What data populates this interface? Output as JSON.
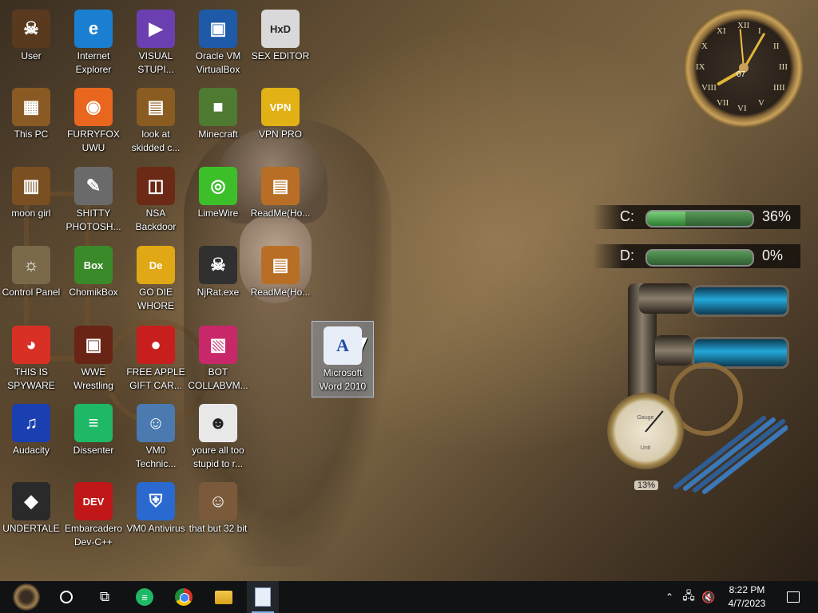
{
  "desktop": {
    "icons": [
      {
        "label": "User",
        "glyph": "☠",
        "bg": "#5a3a1e",
        "col": 0,
        "row": 0
      },
      {
        "label": "Internet Explorer",
        "glyph": "e",
        "bg": "#1a7fd0",
        "col": 1,
        "row": 0
      },
      {
        "label": "VISUAL STUPI...",
        "glyph": "▶",
        "bg": "#6b3fb0",
        "col": 2,
        "row": 0
      },
      {
        "label": "Oracle VM VirtualBox",
        "glyph": "▣",
        "bg": "#1f5aa8",
        "col": 3,
        "row": 0
      },
      {
        "label": "SEX EDITOR",
        "glyph": "HxD",
        "bg": "#d9d9d9",
        "col": 4,
        "row": 0
      },
      {
        "label": "This PC",
        "glyph": "▦",
        "bg": "#8a5a24",
        "col": 0,
        "row": 1
      },
      {
        "label": "FURRYFOX UWU",
        "glyph": "◉",
        "bg": "#e8661e",
        "col": 1,
        "row": 1
      },
      {
        "label": "look at skidded c...",
        "glyph": "▤",
        "bg": "#8a5c22",
        "col": 2,
        "row": 1
      },
      {
        "label": "Minecraft",
        "glyph": "■",
        "bg": "#4e7a32",
        "col": 3,
        "row": 1
      },
      {
        "label": "VPN PRO",
        "glyph": "VPN",
        "bg": "#e2b116",
        "col": 4,
        "row": 1
      },
      {
        "label": "moon girl",
        "glyph": "▥",
        "bg": "#7a5022",
        "col": 0,
        "row": 2
      },
      {
        "label": "SHITTY PHOTOSH...",
        "glyph": "✎",
        "bg": "#6a6a6a",
        "col": 1,
        "row": 2
      },
      {
        "label": "NSA Backdoor",
        "glyph": "◫",
        "bg": "#6a2a16",
        "col": 2,
        "row": 2
      },
      {
        "label": "LimeWire",
        "glyph": "◎",
        "bg": "#3dbf2a",
        "col": 3,
        "row": 2
      },
      {
        "label": "ReadMe(Ho...",
        "glyph": "▤",
        "bg": "#b86f25",
        "col": 4,
        "row": 2
      },
      {
        "label": "Control Panel",
        "glyph": "☼",
        "bg": "#7a6a4a",
        "col": 0,
        "row": 3
      },
      {
        "label": "ChomikBox",
        "glyph": "Box",
        "bg": "#3a8a2a",
        "col": 1,
        "row": 3
      },
      {
        "label": "GO DIE WHORE",
        "glyph": "De",
        "bg": "#e0a814",
        "col": 2,
        "row": 3
      },
      {
        "label": "NjRat.exe",
        "glyph": "☠",
        "bg": "#303030",
        "col": 3,
        "row": 3
      },
      {
        "label": "ReadMe(Ho...",
        "glyph": "▤",
        "bg": "#b86f25",
        "col": 4,
        "row": 3
      },
      {
        "label": "THIS IS SPYWARE",
        "glyph": "◕",
        "bg": "#d93025",
        "col": 0,
        "row": 4
      },
      {
        "label": "WWE Wrestling",
        "glyph": "▣",
        "bg": "#6a2416",
        "col": 1,
        "row": 4
      },
      {
        "label": "FREE APPLE GIFT CAR...",
        "glyph": "●",
        "bg": "#c81e1e",
        "col": 2,
        "row": 4
      },
      {
        "label": "BOT COLLABVM...",
        "glyph": "▧",
        "bg": "#c8286a",
        "col": 3,
        "row": 4
      },
      {
        "label": "Audacity",
        "glyph": "♫",
        "bg": "#1a3fb0",
        "col": 0,
        "row": 5
      },
      {
        "label": "Dissenter",
        "glyph": "≡",
        "bg": "#1fb866",
        "col": 1,
        "row": 5
      },
      {
        "label": "VM0 Technic...",
        "glyph": "☺",
        "bg": "#4a7ab0",
        "col": 2,
        "row": 5
      },
      {
        "label": "youre all too stupid to r...",
        "glyph": "☻",
        "bg": "#e8e8e8",
        "col": 3,
        "row": 5
      },
      {
        "label": "UNDERTALE",
        "glyph": "◆",
        "bg": "#2a2a2a",
        "col": 0,
        "row": 6
      },
      {
        "label": "Embarcadero Dev-C++",
        "glyph": "DEV",
        "bg": "#c01818",
        "col": 1,
        "row": 6
      },
      {
        "label": "VM0 Antivirus",
        "glyph": "⛨",
        "bg": "#2a6ad0",
        "col": 2,
        "row": 6
      },
      {
        "label": "that but 32 bit",
        "glyph": "☺",
        "bg": "#7a5a3a",
        "col": 3,
        "row": 6
      }
    ],
    "selected_icon": {
      "label": "Microsoft Word 2010",
      "glyph": "A"
    }
  },
  "clock_widget": {
    "numerals": [
      "XII",
      "I",
      "II",
      "III",
      "IIII",
      "V",
      "VI",
      "VII",
      "VIII",
      "IX",
      "X",
      "XI"
    ],
    "day": "07"
  },
  "drives": [
    {
      "letter": "C:",
      "percent_text": "36%",
      "used": 0.36
    },
    {
      "letter": "D:",
      "percent_text": "0%",
      "used": 0.0
    }
  ],
  "gauge": {
    "percent_text": "13%",
    "dial_label_top": "Gauge",
    "dial_label_bottom": "Unit"
  },
  "taskbar": {
    "start": "start-icon",
    "items": [
      "search-circle-icon",
      "task-view-icon",
      "dissenter-icon",
      "chrome-icon",
      "file-explorer-icon",
      "word-icon"
    ],
    "time": "8:22 PM",
    "date": "4/7/2023"
  },
  "colors": {
    "taskbar": "#101214",
    "accent": "#7fb3e6",
    "selection": "#a0bee6"
  }
}
